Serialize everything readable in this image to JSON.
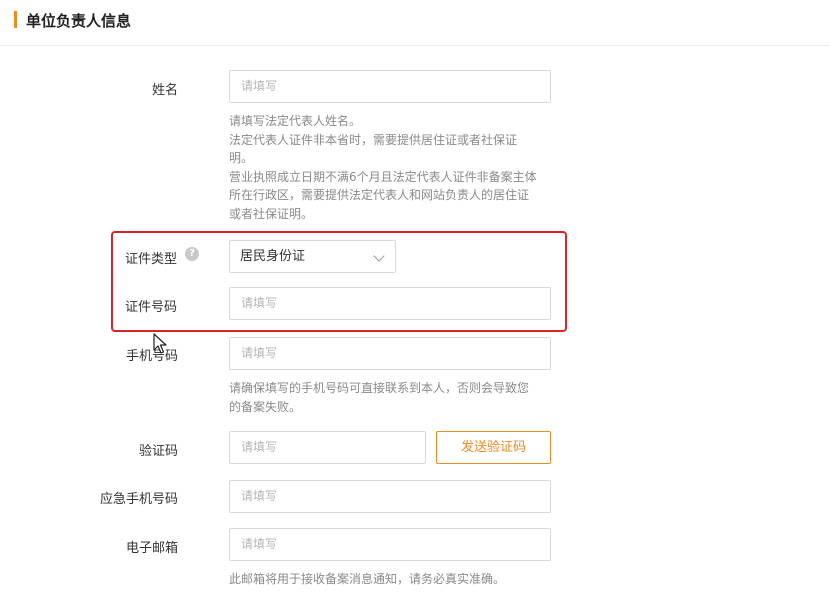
{
  "section": {
    "title": "单位负责人信息"
  },
  "name": {
    "label": "姓名",
    "placeholder": "请填写",
    "help_lines": [
      "请填写法定代表人姓名。",
      "法定代表人证件非本省时，需要提供居住证或者社保证",
      "明。",
      "营业执照成立日期不满6个月且法定代表人证件非备案主体",
      "所在行政区，需要提供法定代表人和网站负责人的居住证",
      "或者社保证明。"
    ]
  },
  "id_type": {
    "label": "证件类型",
    "help_icon": "question-circle-icon",
    "value": "居民身份证"
  },
  "id_number": {
    "label": "证件号码",
    "placeholder": "请填写"
  },
  "phone": {
    "label": "手机号码",
    "placeholder": "请填写",
    "help_lines": [
      "请确保填写的手机号码可直接联系到本人，否则会导致您",
      "的备案失败。"
    ]
  },
  "code": {
    "label": "验证码",
    "placeholder": "请填写",
    "send_label": "发送验证码"
  },
  "emergency_phone": {
    "label": "应急手机号码",
    "placeholder": "请填写"
  },
  "email": {
    "label": "电子邮箱",
    "placeholder": "请填写",
    "help_lines": [
      "此邮箱将用于接收备案消息通知，请务必真实准确。"
    ]
  },
  "colors": {
    "accent": "#f08a24",
    "highlight": "#d9252a"
  }
}
